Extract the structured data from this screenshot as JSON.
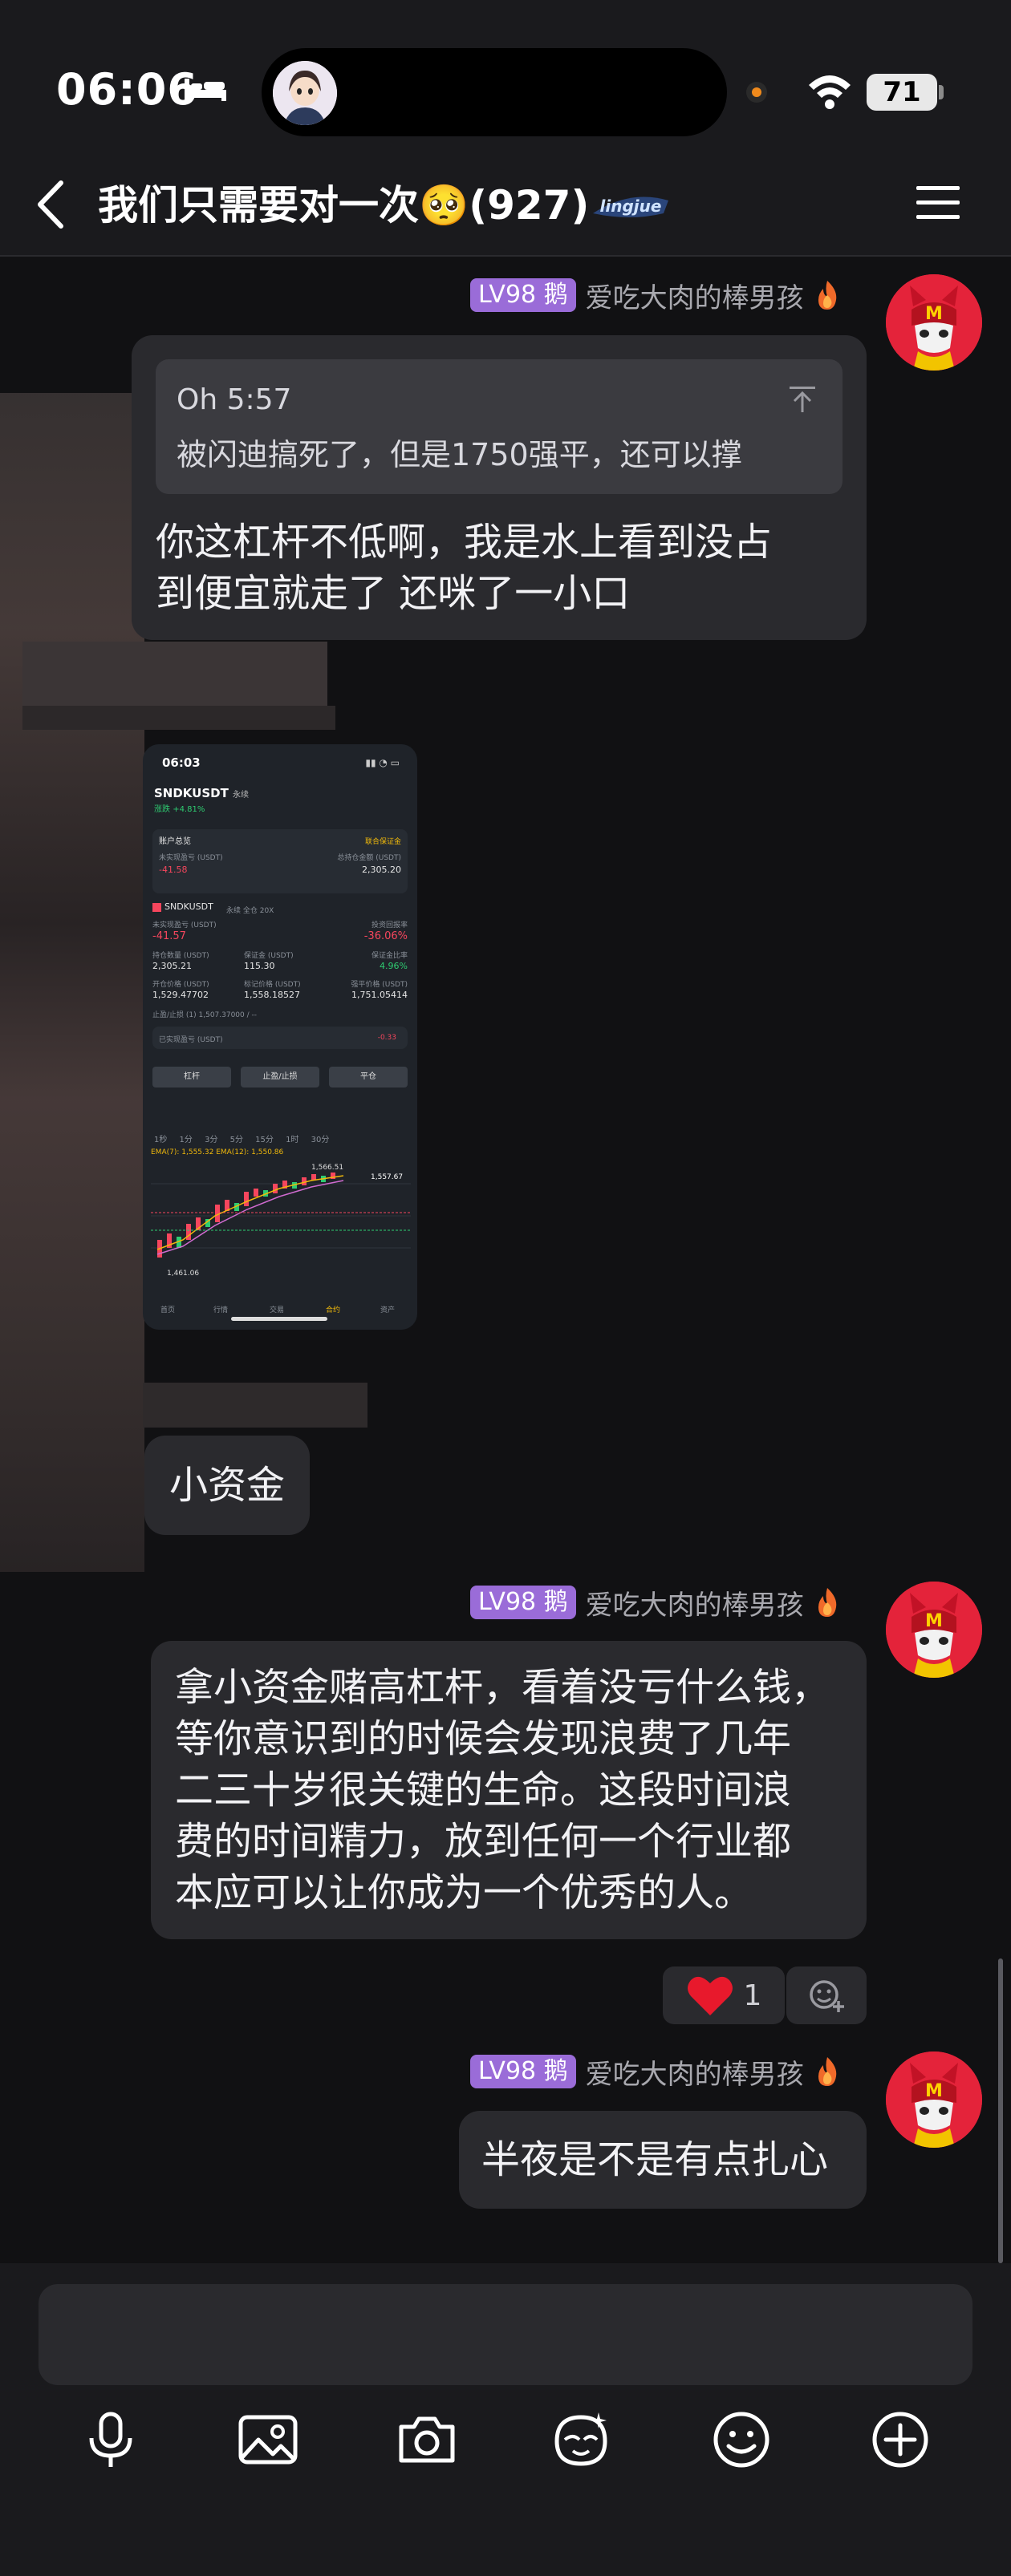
{
  "status_bar": {
    "time": "06:06",
    "battery": "71"
  },
  "header": {
    "title": "我们只需要对一次🥺(927)",
    "badge_text": "lingjue"
  },
  "messages": [
    {
      "sender": {
        "level": "LV98 鹅",
        "nickname": "爱吃大肉的棒男孩"
      },
      "quote": {
        "head": "Oh 5:57",
        "text": "被闪迪搞死了，但是1750强平，还可以撑"
      },
      "lines": [
        "你这杠杆不低啊，我是水上看到没占",
        "到便宜就走了 还咪了一小口"
      ]
    },
    {
      "screenshot": {
        "time": "06:03",
        "symbol": "SNDKUSDT",
        "perp": "永续",
        "change_label": "涨跌",
        "change": "+4.81%",
        "account_title": "账户总览",
        "account_mode": "联合保证金",
        "unrealized_label": "未实现盈亏 (USDT)",
        "unrealized": "-41.58",
        "equity_label": "总持仓金额 (USDT)",
        "equity": "2,305.20",
        "pos_symbol": "SNDKUSDT",
        "pos_tags": "永续  全仓 20X",
        "pnl_label": "未实现盈亏 (USDT)",
        "pnl": "-41.57",
        "roi_label": "投资回报率",
        "roi": "-36.06%",
        "size_label": "持仓数量 (USDT)",
        "size": "2,305.21",
        "margin_label": "保证金 (USDT)",
        "margin": "115.30",
        "margin_ratio_label": "保证金比率",
        "margin_ratio": "4.96%",
        "entry_label": "开仓价格 (USDT)",
        "entry": "1,529.47702",
        "mark_label": "标记价格 (USDT)",
        "mark": "1,558.18527",
        "liq_label": "强平价格 (USDT)",
        "liq": "1,751.05414",
        "tpsl": "止盈/止损 (1) 1,507.37000 / --",
        "realized_label": "已实现盈亏 (USDT)",
        "realized": "-0.33",
        "btn_leverage": "杠杆",
        "btn_tpsl": "止盈/止损",
        "btn_close": "平仓",
        "tabs": "1秒 1分 3分 5分 15分 1时 30分",
        "ema": "EMA(7): 1,555.32  EMA(12): 1,550.86",
        "price_high": "1,566.51",
        "price_last": "1,557.67",
        "price_low": "1,461.06",
        "nav_items": [
          "首页",
          "行情",
          "交易",
          "合约",
          "资产"
        ]
      }
    },
    {
      "text": "小资金"
    },
    {
      "sender": {
        "level": "LV98 鹅",
        "nickname": "爱吃大肉的棒男孩"
      },
      "lines": [
        "拿小资金赌高杠杆，看着没亏什么钱，",
        "等你意识到的时候会发现浪费了几年",
        "二三十岁很关键的生命。这段时间浪",
        "费的时间精力，放到任何一个行业都",
        "本应可以让你成为一个优秀的人。"
      ],
      "reaction_count": "1"
    },
    {
      "sender": {
        "level": "LV98 鹅",
        "nickname": "爱吃大肉的棒男孩"
      },
      "text": "半夜是不是有点扎心"
    }
  ],
  "icons": {
    "back": "chevron-left-icon",
    "menu": "hamburger-menu-icon",
    "tools": [
      "microphone-icon",
      "image-icon",
      "camera-icon",
      "sticker-icon",
      "emoji-icon",
      "plus-icon"
    ]
  },
  "colors": {
    "accent_badge": "#9a6cd8",
    "bubble": "#2a2a2e",
    "background": "#111113",
    "avatar_red": "#e4233a"
  }
}
